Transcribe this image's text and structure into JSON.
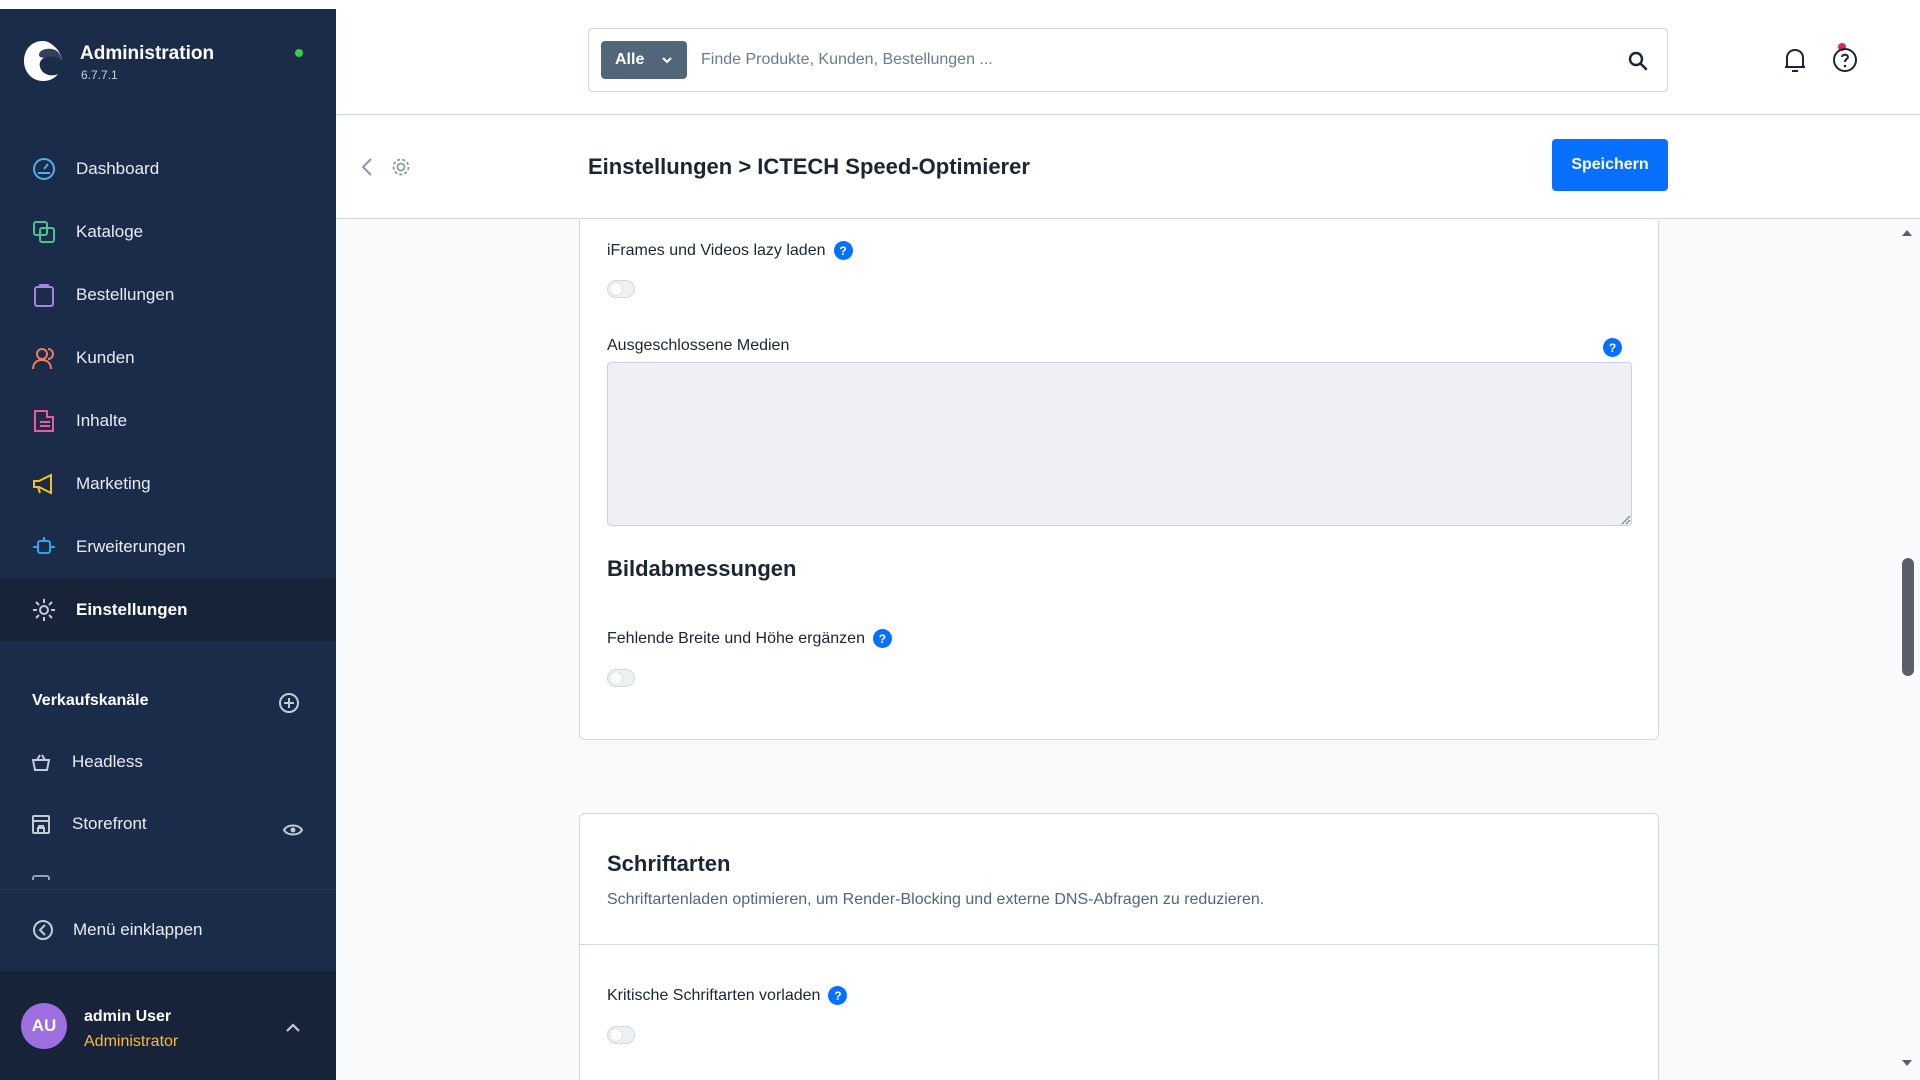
{
  "app": {
    "title": "Administration",
    "version": "6.7.7.1",
    "status_color": "#37d046"
  },
  "sidebar": {
    "items": [
      {
        "label": "Dashboard",
        "icon": "dashboard-gauge-icon",
        "color": "#4fb0e6"
      },
      {
        "label": "Kataloge",
        "icon": "catalog-icon",
        "color": "#49c38f"
      },
      {
        "label": "Bestellungen",
        "icon": "orders-bag-icon",
        "color": "#a685e2"
      },
      {
        "label": "Kunden",
        "icon": "customers-icon",
        "color": "#f07c5c"
      },
      {
        "label": "Inhalte",
        "icon": "content-icon",
        "color": "#ed5b99"
      },
      {
        "label": "Marketing",
        "icon": "marketing-megaphone-icon",
        "color": "#f3c021"
      },
      {
        "label": "Erweiterungen",
        "icon": "extensions-plug-icon",
        "color": "#2fa6e8"
      },
      {
        "label": "Einstellungen",
        "icon": "settings-gear-icon",
        "color": "#c2cbd6",
        "active": true
      }
    ],
    "sales_channels": {
      "heading": "Verkaufskanäle",
      "items": [
        {
          "label": "Headless",
          "icon": "basket-icon"
        },
        {
          "label": "Storefront",
          "icon": "storefront-icon"
        }
      ]
    },
    "collapse_label": "Menü einklappen",
    "user": {
      "initials": "AU",
      "name": "admin User",
      "role": "Administrator"
    }
  },
  "header": {
    "search": {
      "filter_label": "Alle",
      "placeholder": "Finde Produkte, Kunden, Bestellungen ...",
      "value": ""
    }
  },
  "smartbar": {
    "title": "Einstellungen > ICTECH Speed-Optimierer",
    "save_label": "Speichern"
  },
  "main": {
    "card1": {
      "lazy_iframes_label": "iFrames und Videos lazy laden",
      "lazy_iframes_enabled": false,
      "excluded_media_label": "Ausgeschlossene Medien",
      "excluded_media_value": "",
      "image_dims_heading": "Bildabmessungen",
      "missing_dims_label": "Fehlende Breite und Höhe ergänzen",
      "missing_dims_enabled": false
    },
    "card2": {
      "title": "Schriftarten",
      "subtitle": "Schriftartenladen optimieren, um Render-Blocking und externe DNS-Abfragen zu reduzieren.",
      "preload_fonts_label": "Kritische Schriftarten vorladen",
      "preload_fonts_enabled": false
    },
    "help_glyph": "?"
  },
  "colors": {
    "sidebar_bg": "#1b2c4b",
    "primary": "#0870ff",
    "role_color": "#ffb93b",
    "notification_dot": "#de294c"
  }
}
